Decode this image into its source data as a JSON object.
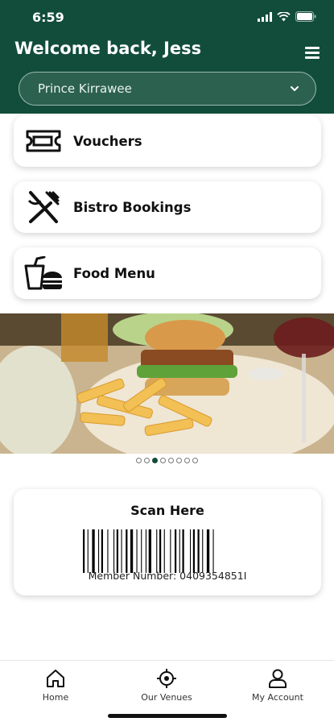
{
  "status_bar": {
    "time": "6:59"
  },
  "header": {
    "welcome": "Welcome back, Jess",
    "venue_selected": "Prince Kirrawee",
    "bg_color": "#124d3b"
  },
  "cards": [
    {
      "label": "Vouchers",
      "icon": "ticket-icon"
    },
    {
      "label": "Bistro Bookings",
      "icon": "utensils-icon"
    },
    {
      "label": "Food Menu",
      "icon": "drink-burger-icon"
    }
  ],
  "carousel": {
    "total": 8,
    "active_index": 2
  },
  "scan": {
    "title": "Scan Here",
    "member_number": "Member Number: 0409354851I"
  },
  "bottom_nav": [
    {
      "label": "Home",
      "icon": "home-icon"
    },
    {
      "label": "Our Venues",
      "icon": "location-target-icon"
    },
    {
      "label": "My Account",
      "icon": "user-icon"
    }
  ]
}
